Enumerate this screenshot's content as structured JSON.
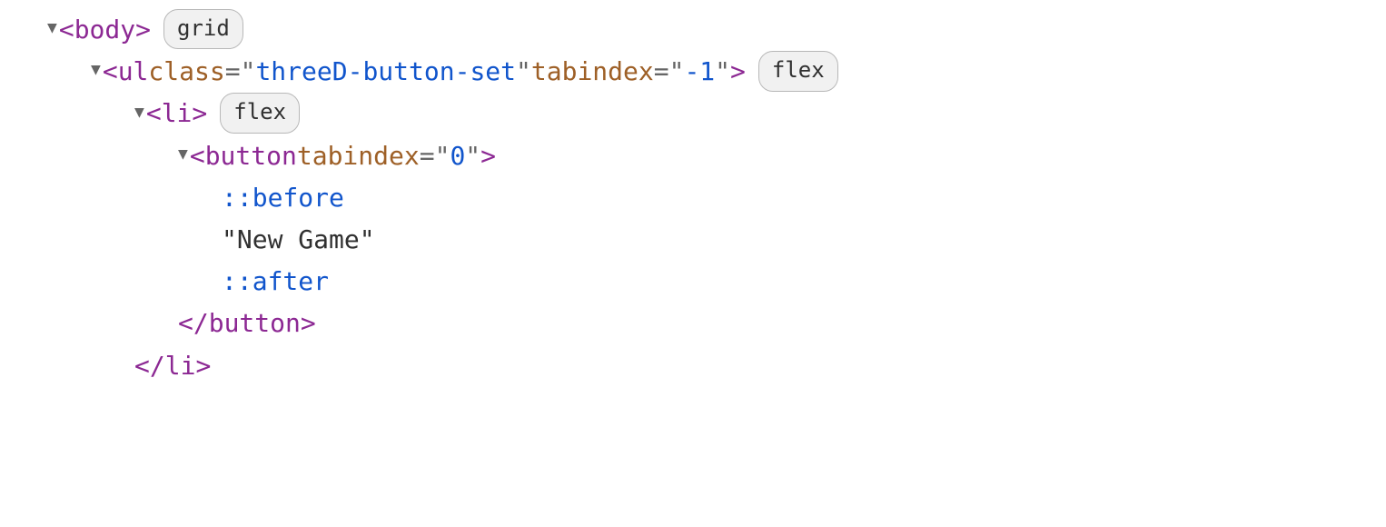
{
  "rows": [
    {
      "indent": 0,
      "arrow": "▼",
      "openTag": "body",
      "attrs": [],
      "selfClose": false,
      "badge": "grid"
    },
    {
      "indent": 1,
      "arrow": "▼",
      "openTag": "ul",
      "attrs": [
        {
          "name": "class",
          "value": "threeD-button-set"
        },
        {
          "name": "tabindex",
          "value": "-1"
        }
      ],
      "selfClose": false,
      "badge": "flex"
    },
    {
      "indent": 2,
      "arrow": "▼",
      "openTag": "li",
      "attrs": [],
      "selfClose": false,
      "badge": "flex"
    },
    {
      "indent": 3,
      "arrow": "▼",
      "openTag": "button",
      "attrs": [
        {
          "name": "tabindex",
          "value": "0"
        }
      ],
      "selfClose": false,
      "badge": null
    },
    {
      "indent": 4,
      "pseudo": "::before"
    },
    {
      "indent": 4,
      "textContent": "\"New Game\""
    },
    {
      "indent": 4,
      "pseudo": "::after"
    },
    {
      "indent": 3,
      "closeTag": "button"
    },
    {
      "indent": 2,
      "closeTag": "li"
    }
  ]
}
